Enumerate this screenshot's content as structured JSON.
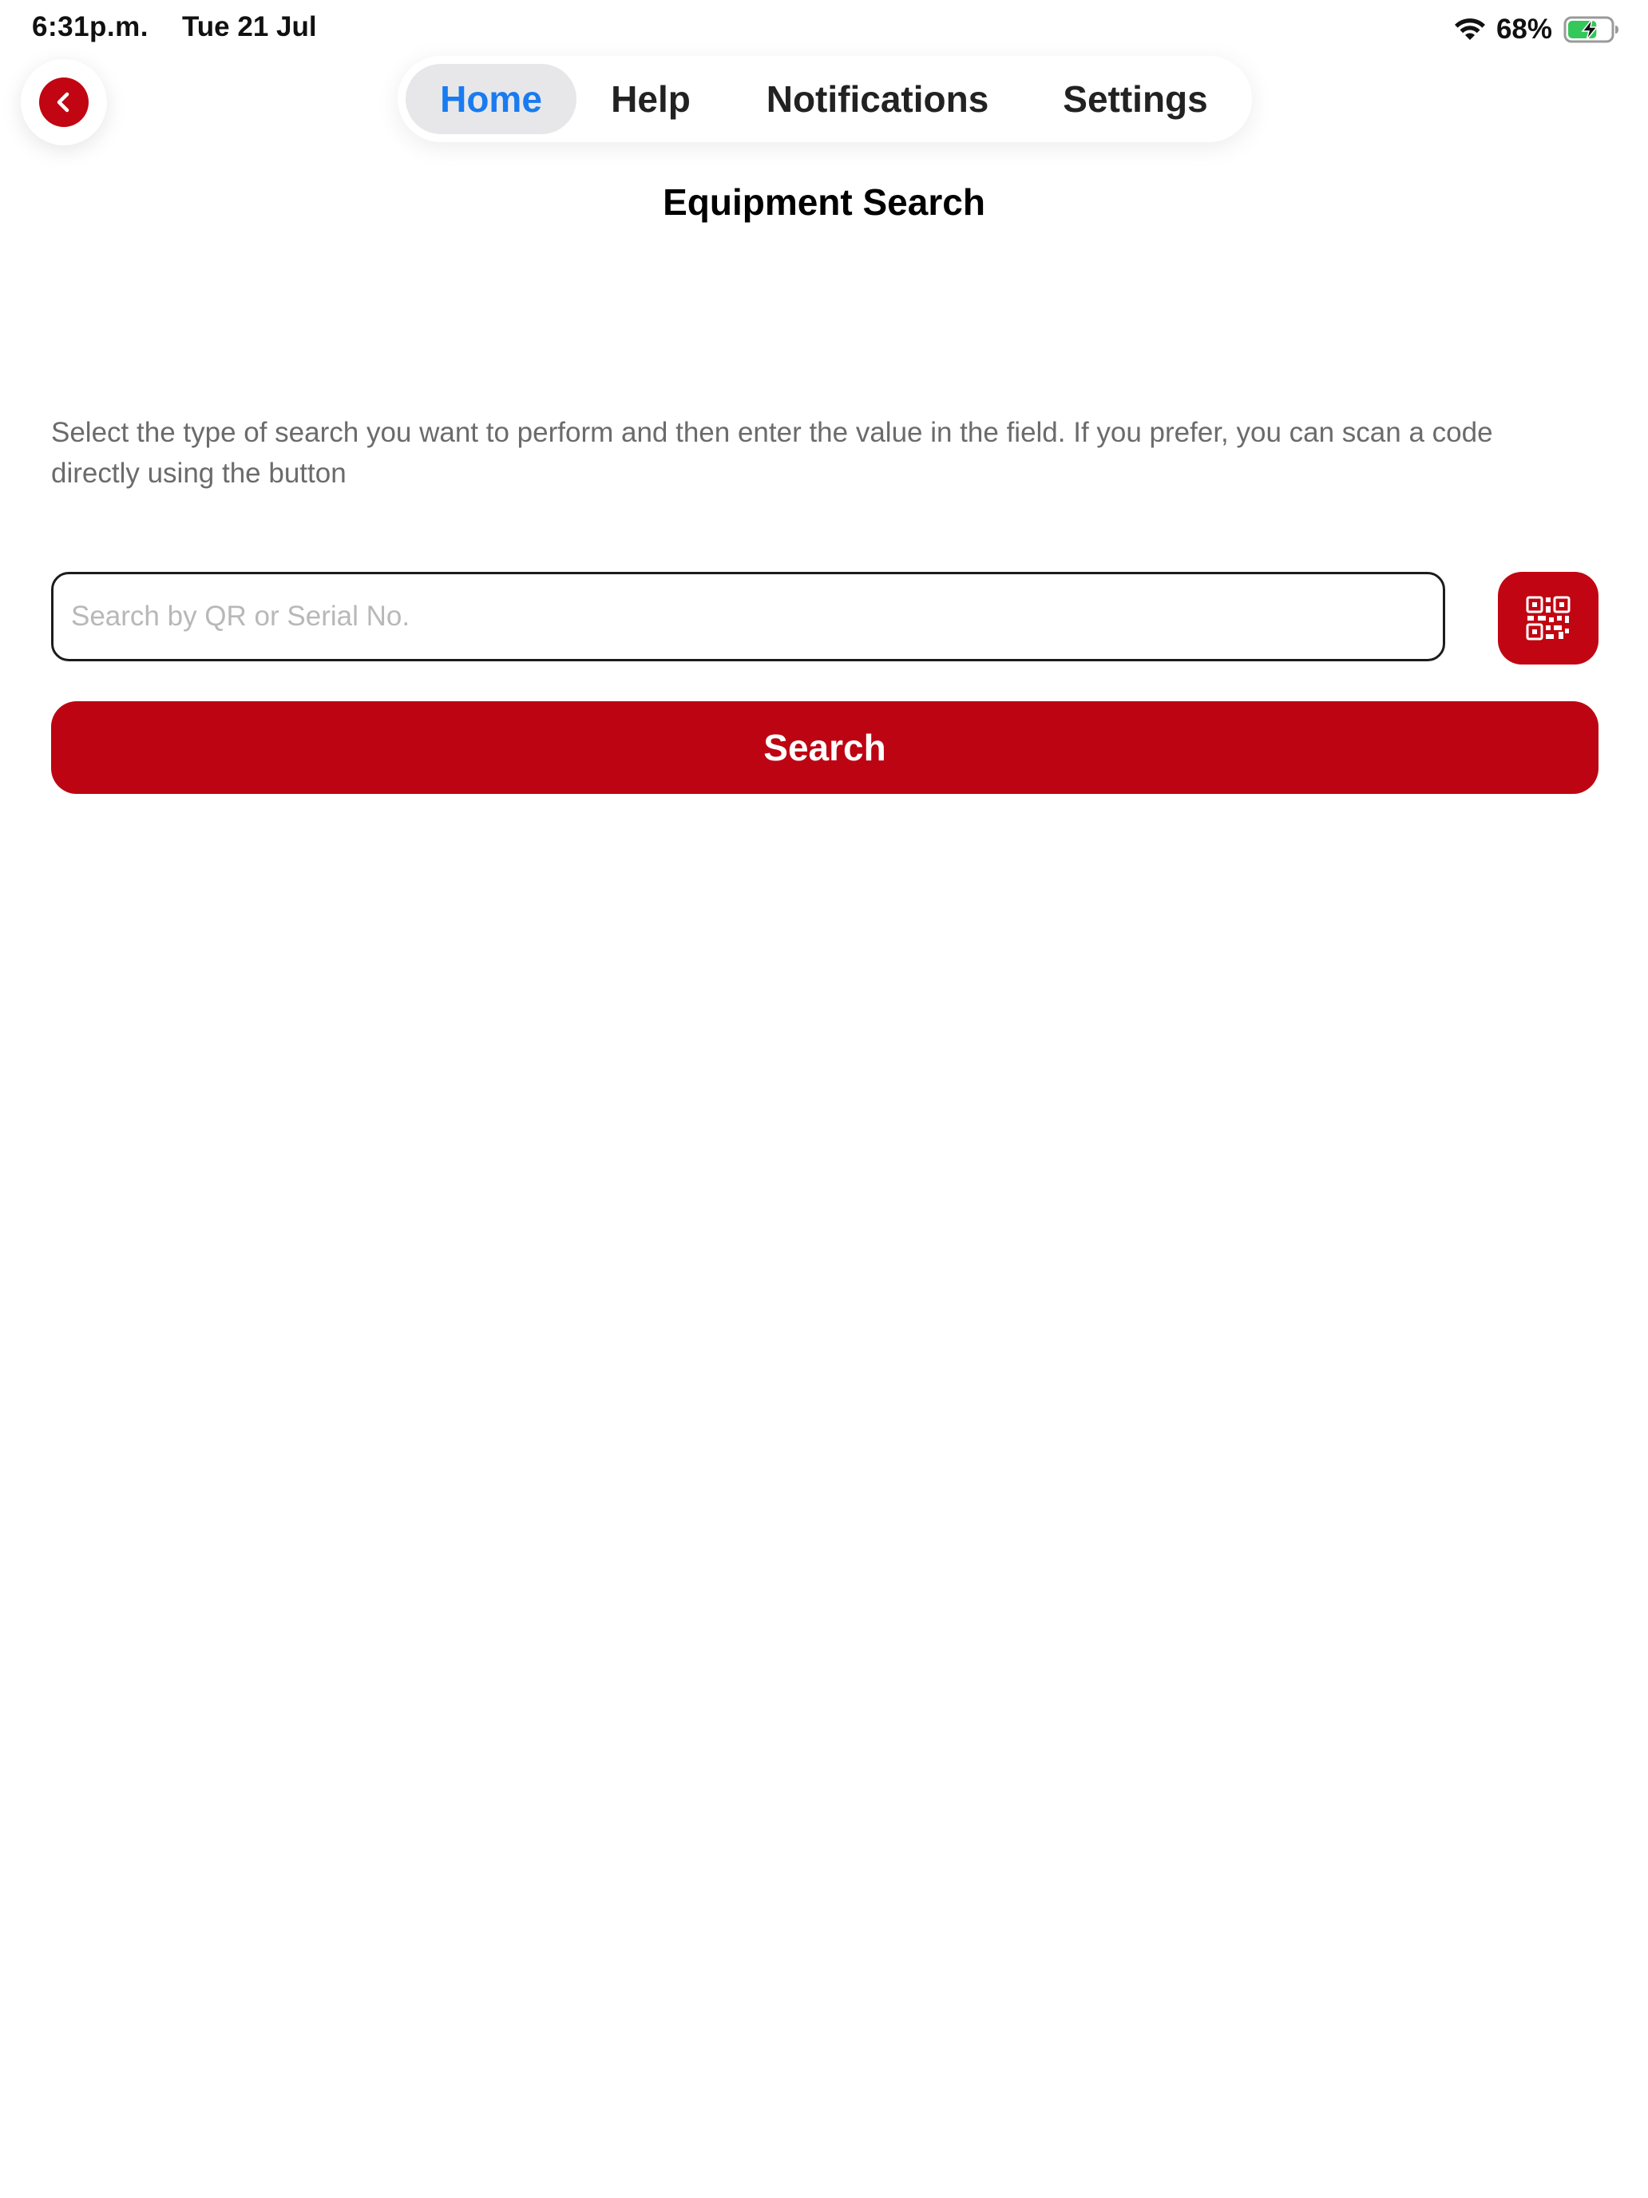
{
  "status_bar": {
    "time": "6:31p.m.",
    "date": "Tue 21 Jul",
    "battery_percent": "68%",
    "battery_level": 0.68,
    "wifi_icon": "wifi-icon",
    "battery_icon": "battery-charging-icon"
  },
  "nav": {
    "back_icon": "chevron-left-icon",
    "tabs": [
      {
        "label": "Home",
        "active": true
      },
      {
        "label": "Help",
        "active": false
      },
      {
        "label": "Notifications",
        "active": false
      },
      {
        "label": "Settings",
        "active": false
      }
    ]
  },
  "page": {
    "title": "Equipment Search",
    "instructions": "Select the type of search you want to perform and then enter the value in the field. If you prefer, you can scan a code directly using the button"
  },
  "search": {
    "placeholder": "Search by QR or Serial No.",
    "value": "",
    "scan_icon": "qr-code-icon",
    "button_label": "Search"
  },
  "colors": {
    "brand_red": "#c10512",
    "active_tab_text": "#1a7bf0",
    "active_tab_bg": "#e7e7ea",
    "battery_green": "#34c759"
  }
}
